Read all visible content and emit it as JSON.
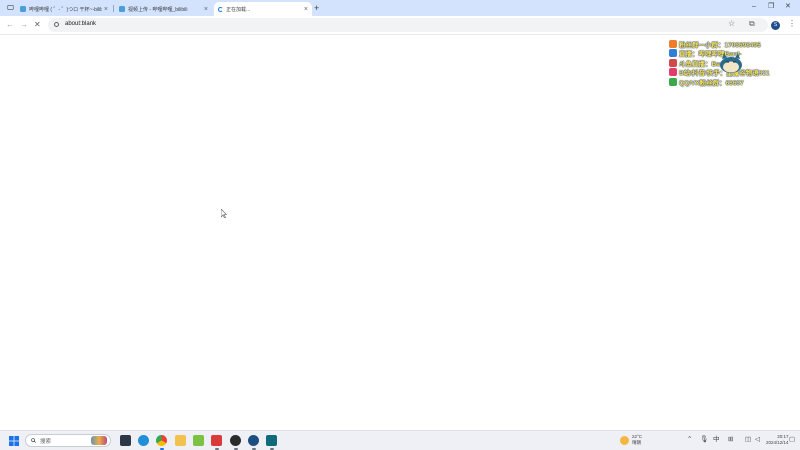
{
  "browser": {
    "tabs": [
      {
        "title": "哔哩哔哩 ( ゜- ゜)つロ 干杯~-bilibili",
        "state": "inactive",
        "icon": "bilibili-icon"
      },
      {
        "title": "视频上传 - 哔哩哔哩_bilibili",
        "state": "inactive",
        "icon": "bilibili-icon"
      },
      {
        "title": "正在加载...",
        "state": "active",
        "icon": "loading-spinner-icon"
      }
    ],
    "new_tab_label": "+",
    "address_bar": {
      "url": "about:blank"
    },
    "profile_initial": "S",
    "accent_color": "#1a73e8",
    "tabstrip_color": "#d3e3fd"
  },
  "overlay": {
    "lines": [
      {
        "icon_color": "#f07d2a",
        "text": "粉丝群一小群：1703698495"
      },
      {
        "icon_color": "#2f7fd8",
        "text": "直播：哔哩哔哩Bard-"
      },
      {
        "icon_color": "#d04a4a",
        "text": "斗鱼直播：Bard321"
      },
      {
        "icon_color": "#e23c6a",
        "text": "B站/抖音/快手：星露谷物语321"
      },
      {
        "icon_color": "#3aa94a",
        "text": "QQ/VX粉丝群：63637"
      }
    ]
  },
  "taskbar": {
    "search_label": "搜索",
    "apps": [
      "task-view-icon",
      "edge-icon",
      "chrome-icon",
      "file-explorer-icon",
      "app-green-icon",
      "app-red-icon",
      "app-dark-icon",
      "steam-icon",
      "app-teal-icon"
    ],
    "weather": {
      "temp": "22°C",
      "condition": "晴朗"
    },
    "ime": "中",
    "clock": {
      "time": "20:17",
      "date": "2024/12/14"
    }
  }
}
